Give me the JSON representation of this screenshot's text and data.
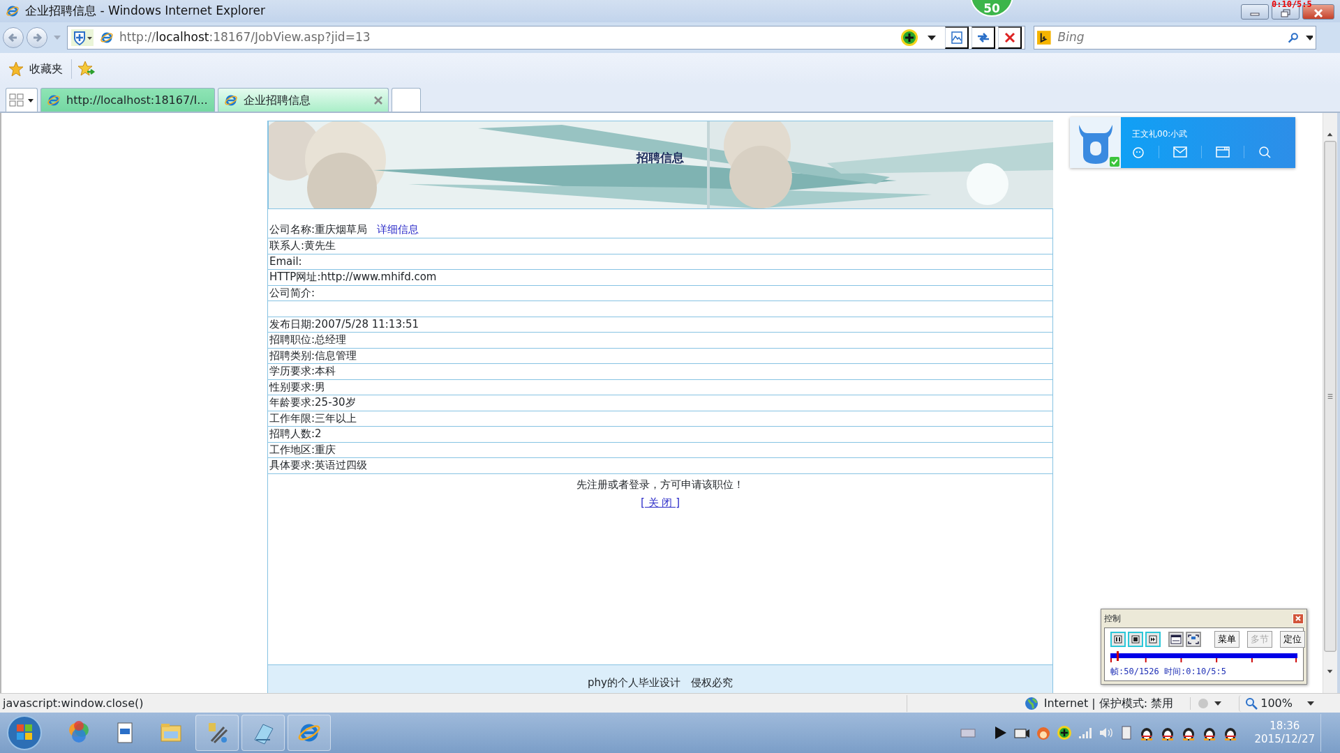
{
  "window": {
    "title": "企业招聘信息 - Windows Internet Explorer"
  },
  "counter_badge": "50",
  "recorder_overlay": "0:10/5:5",
  "address_bar": {
    "url_parts": [
      {
        "text": "http://",
        "kind": "dim"
      },
      {
        "text": "localhost",
        "kind": "host"
      },
      {
        "text": ":18167/JobView.asp?jid=13",
        "kind": "dim"
      }
    ]
  },
  "search_box": {
    "placeholder": "Bing"
  },
  "favorites_bar": {
    "label": "收藏夹"
  },
  "tabs": [
    {
      "label": "http://localhost:18167/I...",
      "selected": false
    },
    {
      "label": "企业招聘信息",
      "selected": true
    }
  ],
  "page": {
    "banner_title": "招聘信息",
    "rows": [
      {
        "kind": "text",
        "text": "公司名称:重庆烟草局",
        "link": "详细信息"
      },
      {
        "kind": "text",
        "text": "联系人:黄先生"
      },
      {
        "kind": "text",
        "text": "Email:"
      },
      {
        "kind": "text",
        "text": "HTTP网址:http://www.mhifd.com"
      },
      {
        "kind": "text",
        "text": "公司简介:"
      },
      {
        "kind": "blank"
      },
      {
        "kind": "text",
        "text": "发布日期:2007/5/28 11:13:51"
      },
      {
        "kind": "text",
        "text": "招聘职位:总经理"
      },
      {
        "kind": "text",
        "text": "招聘类别:信息管理"
      },
      {
        "kind": "text",
        "text": "学历要求:本科"
      },
      {
        "kind": "text",
        "text": "性别要求:男"
      },
      {
        "kind": "text",
        "text": "年龄要求:25-30岁"
      },
      {
        "kind": "text",
        "text": "工作年限:三年以上"
      },
      {
        "kind": "text",
        "text": "招聘人数:2"
      },
      {
        "kind": "text",
        "text": "工作地区:重庆"
      },
      {
        "kind": "text",
        "text": "具体要求:英语过四级"
      }
    ],
    "notice": "先注册或者登录，方可申请该职位！",
    "close_link": "[ 关 闭 ]",
    "footer": "phy的个人毕业设计　侵权必究"
  },
  "qq_panel": {
    "name": "王文礼00:小武"
  },
  "control_panel": {
    "title": "控制",
    "buttons": [
      {
        "label": "菜单",
        "disabled": false
      },
      {
        "label": "多节",
        "disabled": true
      },
      {
        "label": "定位",
        "disabled": false
      }
    ],
    "level": 0.033,
    "info": "帧:50/1526 时间:0:10/5:5"
  },
  "status_bar": {
    "text": "javascript:window.close()",
    "zone": "Internet | 保护模式: 禁用",
    "zoom": "100%"
  },
  "taskbar": {
    "time": "18:36",
    "date": "2015/12/27"
  }
}
